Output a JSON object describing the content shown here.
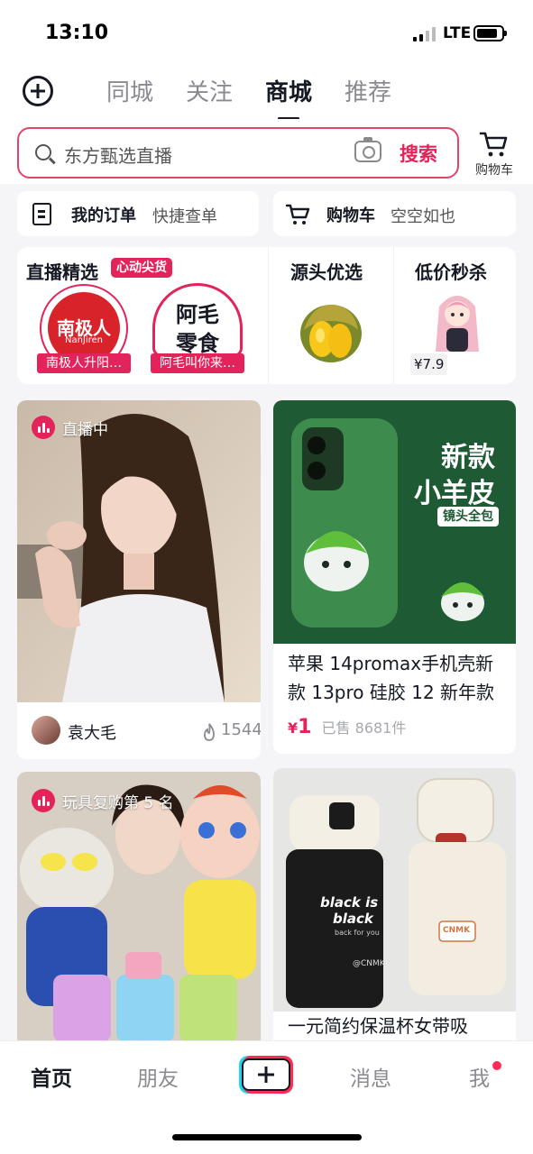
{
  "status": {
    "time": "13:10",
    "network": "LTE"
  },
  "header": {
    "tabs": [
      {
        "label": "同城",
        "active": false
      },
      {
        "label": "关注",
        "active": false
      },
      {
        "label": "商城",
        "active": true
      },
      {
        "label": "推荐",
        "active": false
      }
    ]
  },
  "search": {
    "placeholder": "东方甄选直播",
    "button": "搜索"
  },
  "cart_top": {
    "label": "购物车"
  },
  "quick": {
    "orders": {
      "title": "我的订单",
      "sub": "快捷查单"
    },
    "cart": {
      "title": "购物车",
      "sub": "空空如也"
    }
  },
  "featured": {
    "live": {
      "title": "直播精选",
      "badge": "心动尖货",
      "stores": [
        {
          "logo_text": "南极人",
          "logo_sub": "NanJiren",
          "label": "南极人升阳…"
        },
        {
          "logo_text": "阿毛",
          "logo_sub": "零食",
          "label": "阿毛叫你来…"
        }
      ]
    },
    "source": {
      "title": "源头优选"
    },
    "flash": {
      "title": "低价秒杀",
      "price": "¥7.9"
    }
  },
  "feed": {
    "card1": {
      "badge": "直播中",
      "author": "袁大毛",
      "viewers": "1544"
    },
    "card2": {
      "overlay_title_1": "新款",
      "overlay_title_2": "小羊皮",
      "overlay_tag": "镜头全包",
      "title": "苹果 14promax手机壳新款 13pro 硅胶 12 新年款",
      "price_symbol": "¥",
      "price": "1",
      "sold": "已售 8681件"
    },
    "card3": {
      "badge": "玩具复购第 5 名"
    },
    "card4": {
      "bottle_text_1": "black is",
      "bottle_text_2": "black",
      "bottle_text_3": "back for you",
      "bottle_brand": "@CNMK",
      "bottle_brand_2": "CNMK",
      "title": "一元简约保温杯女带吸"
    }
  },
  "nav": {
    "home": "首页",
    "friends": "朋友",
    "messages": "消息",
    "me": "我"
  },
  "colors": {
    "accent": "#e2245a",
    "brand_cyan": "#21d4e6",
    "brand_red": "#fe2c55"
  }
}
